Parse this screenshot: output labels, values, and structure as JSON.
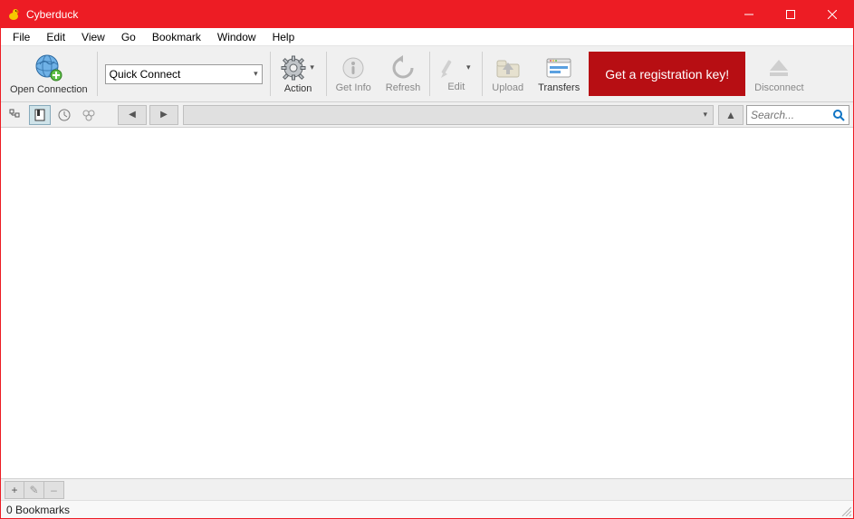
{
  "window": {
    "title": "Cyberduck"
  },
  "menubar": {
    "file": "File",
    "edit": "Edit",
    "view": "View",
    "go": "Go",
    "bookmark": "Bookmark",
    "window": "Window",
    "help": "Help"
  },
  "toolbar": {
    "open_connection": "Open Connection",
    "quick_connect": "Quick Connect",
    "action": "Action",
    "get_info": "Get Info",
    "refresh": "Refresh",
    "edit": "Edit",
    "upload": "Upload",
    "transfers": "Transfers",
    "disconnect": "Disconnect",
    "banner": "Get a registration key!"
  },
  "search": {
    "placeholder": "Search..."
  },
  "footer": {
    "add": "+",
    "edit_glyph": "✎",
    "remove": "–"
  },
  "status": {
    "text": "0 Bookmarks"
  }
}
